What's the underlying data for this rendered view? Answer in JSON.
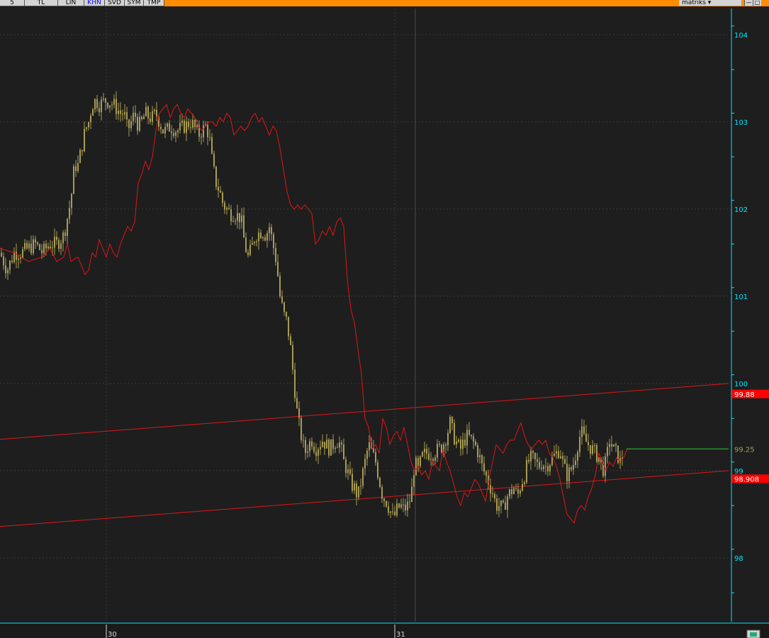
{
  "toolbar": {
    "buttons": [
      {
        "label": "5",
        "active": false
      },
      {
        "label": "TL",
        "active": false
      },
      {
        "label": "LIN",
        "active": false
      },
      {
        "label": "KHN",
        "active": true
      },
      {
        "label": "SVD",
        "active": false
      },
      {
        "label": "SYM",
        "active": false
      },
      {
        "label": "TMP",
        "active": false
      }
    ],
    "brand": "matriks"
  },
  "chart_data": {
    "type": "candlestick",
    "ylim": [
      97.5,
      104.3
    ],
    "yticks": [
      "104",
      "103",
      "102",
      "101",
      "100",
      "99",
      "98"
    ],
    "xticks": [
      "30",
      "31"
    ],
    "last_price_label": "99.25",
    "channel_upper_label": "99.88",
    "channel_lower_label": "98.908",
    "colors": {
      "background": "#1e1e1e",
      "candles": "#a89c56",
      "overlay_line": "#e01616",
      "channel_lines": "#e01616",
      "last_price_line": "#33cc33",
      "axis": "#00e5ff",
      "grid": "#3a3a3a"
    },
    "channel_upper": [
      [
        0,
        99.36
      ],
      [
        1028,
        100.0
      ]
    ],
    "channel_lower": [
      [
        0,
        98.36
      ],
      [
        1028,
        99.0
      ]
    ],
    "candle_path": [
      [
        0,
        101.5
      ],
      [
        10,
        101.3
      ],
      [
        20,
        101.5
      ],
      [
        30,
        101.5
      ],
      [
        40,
        101.55
      ],
      [
        50,
        101.6
      ],
      [
        60,
        101.5
      ],
      [
        70,
        101.6
      ],
      [
        80,
        101.6
      ],
      [
        90,
        101.7
      ],
      [
        95,
        101.9
      ],
      [
        100,
        102.1
      ],
      [
        105,
        102.5
      ],
      [
        110,
        102.5
      ],
      [
        115,
        102.7
      ],
      [
        120,
        102.9
      ],
      [
        125,
        103.0
      ],
      [
        130,
        103.2
      ],
      [
        135,
        103.25
      ],
      [
        140,
        103.2
      ],
      [
        150,
        103.25
      ],
      [
        160,
        103.2
      ],
      [
        170,
        103.1
      ],
      [
        175,
        103.1
      ],
      [
        180,
        102.9
      ],
      [
        185,
        103.0
      ],
      [
        190,
        103.1
      ],
      [
        195,
        102.95
      ],
      [
        200,
        103.0
      ],
      [
        205,
        103.1
      ],
      [
        210,
        103.05
      ],
      [
        215,
        103.05
      ],
      [
        220,
        103.1
      ],
      [
        225,
        103.0
      ],
      [
        230,
        102.9
      ],
      [
        235,
        102.9
      ],
      [
        240,
        102.95
      ],
      [
        250,
        102.9
      ],
      [
        260,
        102.95
      ],
      [
        270,
        103.0
      ],
      [
        280,
        102.85
      ],
      [
        285,
        102.9
      ],
      [
        290,
        102.95
      ],
      [
        295,
        102.85
      ],
      [
        300,
        102.5
      ],
      [
        305,
        102.3
      ],
      [
        310,
        102.2
      ],
      [
        315,
        102.05
      ],
      [
        320,
        102.0
      ],
      [
        325,
        101.95
      ],
      [
        330,
        101.95
      ],
      [
        340,
        101.9
      ],
      [
        345,
        101.6
      ],
      [
        350,
        101.45
      ],
      [
        355,
        101.55
      ],
      [
        360,
        101.7
      ],
      [
        370,
        101.75
      ],
      [
        375,
        101.7
      ],
      [
        380,
        101.8
      ],
      [
        385,
        101.6
      ],
      [
        390,
        101.4
      ],
      [
        395,
        101.0
      ],
      [
        400,
        100.8
      ],
      [
        405,
        100.7
      ],
      [
        410,
        100.4
      ],
      [
        415,
        100.0
      ],
      [
        420,
        99.6
      ],
      [
        425,
        99.4
      ],
      [
        430,
        99.2
      ],
      [
        435,
        99.3
      ],
      [
        440,
        99.35
      ],
      [
        445,
        99.25
      ],
      [
        450,
        99.3
      ],
      [
        455,
        99.35
      ],
      [
        460,
        99.3
      ],
      [
        465,
        99.25
      ],
      [
        470,
        99.3
      ],
      [
        475,
        99.35
      ],
      [
        480,
        99.3
      ],
      [
        485,
        99.1
      ],
      [
        490,
        99.0
      ],
      [
        495,
        98.85
      ],
      [
        500,
        98.8
      ],
      [
        505,
        98.7
      ],
      [
        510,
        98.9
      ],
      [
        515,
        99.1
      ],
      [
        520,
        99.3
      ],
      [
        525,
        99.2
      ],
      [
        530,
        99.1
      ],
      [
        535,
        98.9
      ],
      [
        540,
        98.7
      ],
      [
        545,
        98.65
      ],
      [
        550,
        98.55
      ],
      [
        555,
        98.45
      ],
      [
        560,
        98.55
      ],
      [
        565,
        98.6
      ],
      [
        570,
        98.55
      ],
      [
        575,
        98.6
      ],
      [
        580,
        98.7
      ],
      [
        585,
        99.1
      ],
      [
        590,
        99.0
      ],
      [
        595,
        99.15
      ],
      [
        600,
        99.2
      ],
      [
        610,
        99.2
      ],
      [
        620,
        99.25
      ],
      [
        625,
        99.3
      ],
      [
        630,
        99.4
      ],
      [
        635,
        99.55
      ],
      [
        640,
        99.4
      ],
      [
        645,
        99.3
      ],
      [
        650,
        99.25
      ],
      [
        655,
        99.35
      ],
      [
        660,
        99.4
      ],
      [
        665,
        99.35
      ],
      [
        670,
        99.3
      ],
      [
        675,
        99.2
      ],
      [
        680,
        99.05
      ],
      [
        685,
        98.95
      ],
      [
        690,
        98.85
      ],
      [
        695,
        98.75
      ],
      [
        700,
        98.6
      ],
      [
        705,
        98.6
      ],
      [
        710,
        98.55
      ],
      [
        715,
        98.7
      ],
      [
        720,
        98.75
      ],
      [
        725,
        98.8
      ],
      [
        730,
        98.7
      ],
      [
        735,
        98.85
      ],
      [
        740,
        98.95
      ],
      [
        745,
        99.1
      ],
      [
        750,
        99.15
      ],
      [
        755,
        99.1
      ],
      [
        760,
        99.05
      ],
      [
        765,
        99.1
      ],
      [
        770,
        99.05
      ],
      [
        775,
        99.1
      ],
      [
        780,
        99.15
      ],
      [
        785,
        99.2
      ],
      [
        790,
        99.25
      ],
      [
        795,
        99.05
      ],
      [
        800,
        98.95
      ],
      [
        805,
        99.0
      ],
      [
        810,
        99.1
      ],
      [
        815,
        99.3
      ],
      [
        820,
        99.45
      ],
      [
        825,
        99.35
      ],
      [
        830,
        99.3
      ],
      [
        835,
        99.25
      ],
      [
        840,
        99.2
      ],
      [
        845,
        99.15
      ],
      [
        850,
        99.0
      ],
      [
        855,
        99.1
      ],
      [
        860,
        99.35
      ],
      [
        865,
        99.25
      ],
      [
        870,
        99.2
      ],
      [
        875,
        99.1
      ],
      [
        880,
        99.2
      ]
    ],
    "overlay_line": [
      [
        0,
        101.55
      ],
      [
        20,
        101.5
      ],
      [
        40,
        101.4
      ],
      [
        60,
        101.45
      ],
      [
        70,
        101.55
      ],
      [
        80,
        101.4
      ],
      [
        90,
        101.45
      ],
      [
        95,
        101.6
      ],
      [
        100,
        101.4
      ],
      [
        110,
        101.45
      ],
      [
        115,
        101.35
      ],
      [
        120,
        101.25
      ],
      [
        125,
        101.3
      ],
      [
        130,
        101.5
      ],
      [
        135,
        101.45
      ],
      [
        140,
        101.65
      ],
      [
        145,
        101.55
      ],
      [
        150,
        101.45
      ],
      [
        155,
        101.6
      ],
      [
        160,
        101.5
      ],
      [
        165,
        101.45
      ],
      [
        170,
        101.6
      ],
      [
        175,
        101.7
      ],
      [
        180,
        101.8
      ],
      [
        185,
        101.75
      ],
      [
        190,
        101.85
      ],
      [
        195,
        102.3
      ],
      [
        200,
        102.4
      ],
      [
        205,
        102.55
      ],
      [
        210,
        102.45
      ],
      [
        215,
        102.6
      ],
      [
        220,
        102.9
      ],
      [
        225,
        103.1
      ],
      [
        230,
        103.15
      ],
      [
        235,
        103.2
      ],
      [
        240,
        103.05
      ],
      [
        245,
        103.15
      ],
      [
        250,
        103.2
      ],
      [
        255,
        103.1
      ],
      [
        260,
        103.05
      ],
      [
        265,
        103.15
      ],
      [
        270,
        103.1
      ],
      [
        275,
        103.05
      ],
      [
        280,
        102.95
      ],
      [
        285,
        102.9
      ],
      [
        290,
        102.95
      ],
      [
        295,
        103.0
      ],
      [
        300,
        103.0
      ],
      [
        305,
        102.95
      ],
      [
        310,
        103.05
      ],
      [
        315,
        103.0
      ],
      [
        320,
        103.1
      ],
      [
        325,
        103.05
      ],
      [
        330,
        102.85
      ],
      [
        335,
        102.9
      ],
      [
        340,
        102.95
      ],
      [
        345,
        102.9
      ],
      [
        350,
        102.95
      ],
      [
        355,
        103.05
      ],
      [
        360,
        103.1
      ],
      [
        365,
        103.0
      ],
      [
        370,
        103.05
      ],
      [
        375,
        102.95
      ],
      [
        380,
        102.85
      ],
      [
        385,
        102.95
      ],
      [
        390,
        102.9
      ],
      [
        395,
        102.7
      ],
      [
        400,
        102.45
      ],
      [
        405,
        102.2
      ],
      [
        410,
        102.05
      ],
      [
        415,
        102.0
      ],
      [
        420,
        102.05
      ],
      [
        425,
        102.0
      ],
      [
        430,
        102.05
      ],
      [
        435,
        102.0
      ],
      [
        440,
        101.95
      ],
      [
        445,
        101.6
      ],
      [
        450,
        101.65
      ],
      [
        455,
        101.75
      ],
      [
        460,
        101.7
      ],
      [
        465,
        101.8
      ],
      [
        470,
        101.7
      ],
      [
        475,
        101.85
      ],
      [
        480,
        101.9
      ],
      [
        485,
        101.8
      ],
      [
        490,
        101.2
      ],
      [
        495,
        100.85
      ],
      [
        500,
        100.7
      ],
      [
        505,
        100.4
      ],
      [
        510,
        100.1
      ],
      [
        515,
        99.6
      ],
      [
        520,
        99.5
      ],
      [
        525,
        99.25
      ],
      [
        530,
        99.3
      ],
      [
        535,
        99.2
      ],
      [
        540,
        99.6
      ],
      [
        545,
        99.5
      ],
      [
        550,
        99.3
      ],
      [
        555,
        99.4
      ],
      [
        560,
        99.45
      ],
      [
        565,
        99.35
      ],
      [
        570,
        99.5
      ],
      [
        575,
        99.3
      ],
      [
        580,
        99.1
      ],
      [
        585,
        99.0
      ],
      [
        590,
        99.05
      ],
      [
        595,
        98.95
      ],
      [
        600,
        99.0
      ],
      [
        605,
        98.9
      ],
      [
        610,
        99.1
      ],
      [
        615,
        99.05
      ],
      [
        620,
        99.0
      ],
      [
        625,
        99.25
      ],
      [
        630,
        99.1
      ],
      [
        635,
        99.0
      ],
      [
        640,
        98.85
      ],
      [
        645,
        98.7
      ],
      [
        650,
        98.6
      ],
      [
        655,
        98.75
      ],
      [
        660,
        98.7
      ],
      [
        665,
        98.8
      ],
      [
        670,
        98.9
      ],
      [
        675,
        98.85
      ],
      [
        680,
        98.75
      ],
      [
        685,
        98.65
      ],
      [
        690,
        98.9
      ],
      [
        695,
        99.1
      ],
      [
        700,
        99.3
      ],
      [
        705,
        99.25
      ],
      [
        710,
        99.2
      ],
      [
        715,
        99.3
      ],
      [
        720,
        99.35
      ],
      [
        725,
        99.35
      ],
      [
        730,
        99.45
      ],
      [
        735,
        99.55
      ],
      [
        740,
        99.4
      ],
      [
        745,
        99.3
      ],
      [
        750,
        99.25
      ],
      [
        755,
        99.3
      ],
      [
        760,
        99.35
      ],
      [
        765,
        99.3
      ],
      [
        770,
        99.35
      ],
      [
        775,
        99.2
      ],
      [
        780,
        99.15
      ],
      [
        785,
        99.05
      ],
      [
        790,
        98.9
      ],
      [
        795,
        98.7
      ],
      [
        800,
        98.5
      ],
      [
        805,
        98.45
      ],
      [
        810,
        98.4
      ],
      [
        815,
        98.55
      ],
      [
        820,
        98.6
      ],
      [
        825,
        98.55
      ],
      [
        830,
        98.7
      ],
      [
        835,
        98.8
      ],
      [
        840,
        98.95
      ],
      [
        845,
        99.2
      ],
      [
        850,
        99.1
      ],
      [
        855,
        99.0
      ],
      [
        860,
        99.1
      ],
      [
        865,
        99.05
      ],
      [
        870,
        99.15
      ],
      [
        875,
        99.1
      ],
      [
        880,
        99.15
      ],
      [
        885,
        99.25
      ]
    ]
  }
}
